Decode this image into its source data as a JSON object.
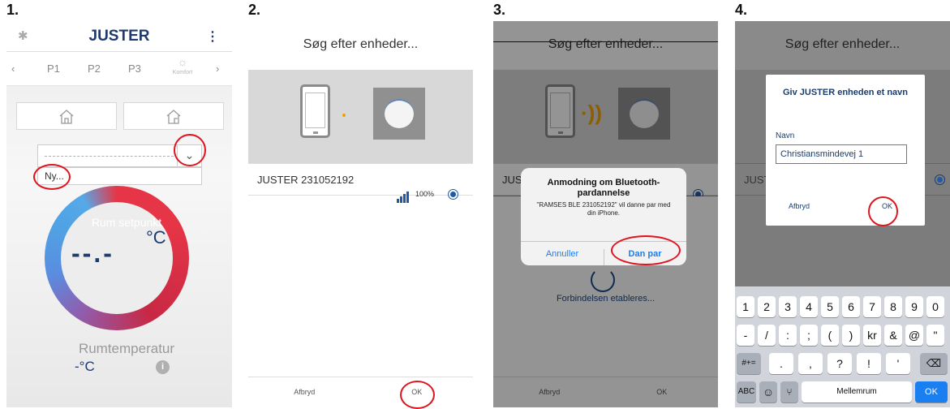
{
  "steps": [
    "1.",
    "2.",
    "3.",
    "4."
  ],
  "screen1": {
    "title": "JUSTER",
    "menu_glyph": "⋮",
    "bluetooth_glyph": "✱",
    "tab_prev": "‹",
    "tab_next": "›",
    "tabs": [
      "P1",
      "P2",
      "P3"
    ],
    "komfort_label": "Komfort",
    "new_option": "Ny...",
    "setpoint_label": "Rum setpunkt",
    "setpoint_unit": "°C",
    "setpoint_value": "--.-",
    "room_temp_label": "Rumtemperatur",
    "room_temp_value": "-°C",
    "info_glyph": "i",
    "accent_color": "#1e3a6e"
  },
  "screen2": {
    "title": "Søg efter enheder...",
    "device_name": "JUSTER 231052192",
    "signal_percent": "100%",
    "cancel_label": "Afbryd",
    "ok_label": "OK"
  },
  "screen3": {
    "title": "Søg efter enheder...",
    "device_name_partial": "JUS",
    "dialog_title": "Anmodning om Bluetooth-pardannelse",
    "dialog_text": "\"RAMSES BLE 231052192\" vil danne par med din iPhone.",
    "dialog_cancel": "Annuller",
    "dialog_pair": "Dan par",
    "connecting_text": "Forbindelsen etableres...",
    "cancel_label": "Afbryd",
    "ok_label": "OK"
  },
  "screen4": {
    "title": "Søg efter enheder...",
    "device_name_partial": "JUST",
    "dialog_title": "Giv JUSTER enheden et navn",
    "name_label": "Navn",
    "name_value": "Christiansmindevej 1",
    "cancel_label": "Afbryd",
    "ok_label": "OK",
    "keyboard_row1": [
      "1",
      "2",
      "3",
      "4",
      "5",
      "6",
      "7",
      "8",
      "9",
      "0"
    ],
    "keyboard_row2": [
      "-",
      "/",
      ":",
      ";",
      "(",
      ")",
      "kr",
      "&",
      "@",
      "\""
    ],
    "keyboard_row3": [
      ".",
      ",",
      "?",
      "!",
      "'"
    ],
    "key_symbols": "#+=",
    "key_abc": "ABC",
    "key_space": "Mellemrum",
    "key_ok": "OK",
    "key_backspace": "⌫",
    "key_emoji": "☺",
    "key_mic": "⑂"
  },
  "highlight_color": "#e0141e"
}
